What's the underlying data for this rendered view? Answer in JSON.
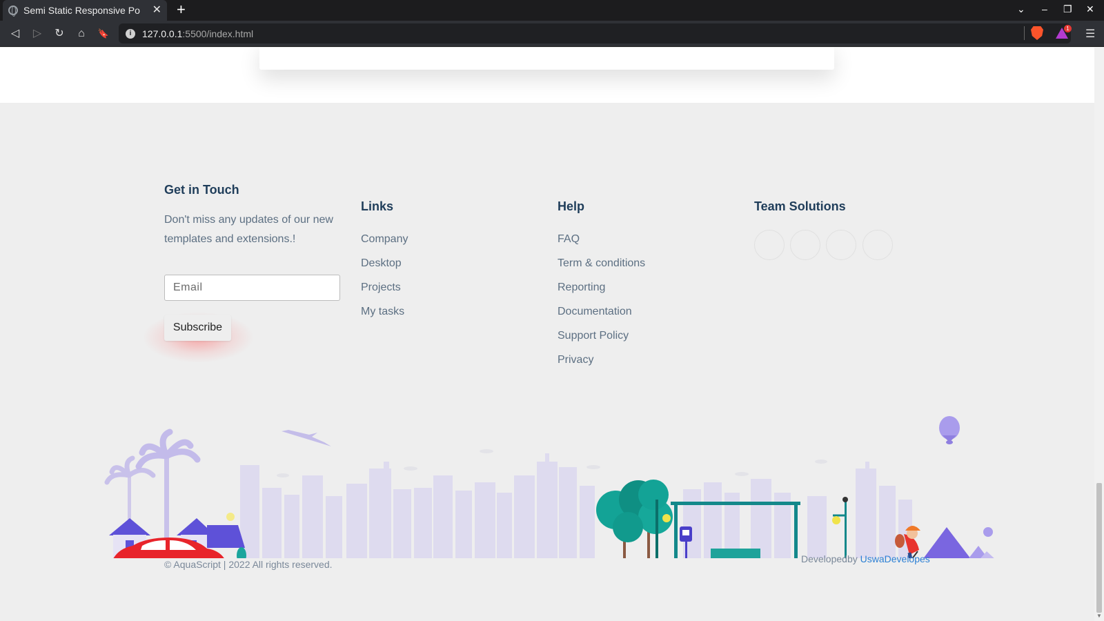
{
  "browser": {
    "tab_title": "Semi Static Responsive Po",
    "tab_close": "✕",
    "new_tab": "+",
    "url_host": "127.0.0.1",
    "url_path": ":5500/index.html",
    "shields_badge": "1",
    "window_controls": {
      "list": "⌄",
      "minimize": "–",
      "restore": "❐",
      "close": "✕"
    },
    "nav": {
      "back": "◁",
      "forward": "▷",
      "reload": "↻",
      "home": "⌂",
      "bookmark": "🔖",
      "menu": "☰"
    }
  },
  "footer": {
    "get_in_touch": {
      "heading": "Get in Touch",
      "text": "Don't miss any updates of our new templates and extensions.!",
      "email_placeholder": "Email",
      "subscribe_label": "Subscribe"
    },
    "links": {
      "heading": "Links",
      "items": [
        "Company",
        "Desktop",
        "Projects",
        "My tasks"
      ]
    },
    "help": {
      "heading": "Help",
      "items": [
        "FAQ",
        "Term & conditions",
        "Reporting",
        "Documentation",
        "Support Policy",
        "Privacy"
      ]
    },
    "team": {
      "heading": "Team Solutions",
      "social_icons": [
        "social-icon-1",
        "social-icon-2",
        "social-icon-3",
        "social-icon-4"
      ]
    },
    "copyright": "© AquaScript | 2022 All rights reserved.",
    "developed_by_prefix": "Developedby",
    "developed_by_link": "UswaDevelopes"
  },
  "colors": {
    "heading": "#1f3d5a",
    "body_text": "#5c6f82",
    "link": "#2b7fd4",
    "skyline": "#dcd9ee",
    "accent_purple": "#8f7fe0",
    "teal": "#14908a",
    "car_red": "#e8242b"
  }
}
